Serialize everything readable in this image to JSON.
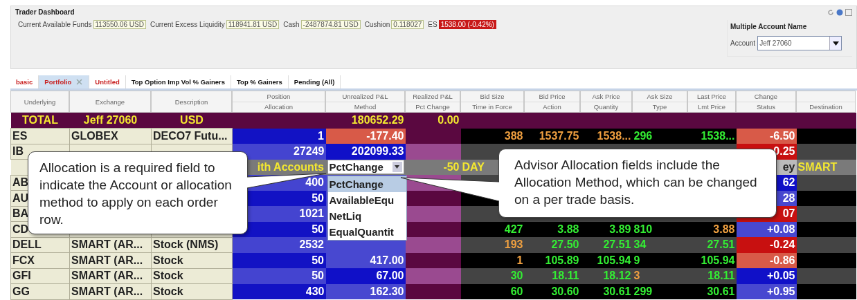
{
  "window": {
    "title": "Trader Dashboard"
  },
  "metrics": [
    {
      "label": "Current Available Funds",
      "value": "113550.06 USD",
      "kind": "plain"
    },
    {
      "label": "Current Excess Liquidity",
      "value": "118941.81 USD",
      "kind": "plain"
    },
    {
      "label": "Cash",
      "value": "-2487874.81 USD",
      "kind": "plain"
    },
    {
      "label": "Cushion",
      "value": "0.118027",
      "kind": "plain"
    },
    {
      "label": "ES",
      "value": "1538.00 (-0.42%)",
      "kind": "alert"
    }
  ],
  "account_panel": {
    "title": "Multiple Account Name",
    "label": "Account",
    "value": "Jeff 27060"
  },
  "tabs": [
    {
      "label": "basic",
      "selected": false,
      "color": "#c82020"
    },
    {
      "label": "Portfolio",
      "selected": true,
      "color": "#c82020"
    },
    {
      "label": "Untitled",
      "selected": false,
      "color": "#c82020"
    },
    {
      "label": "Top Option Imp Vol % Gainers",
      "selected": false,
      "color": "#111111"
    },
    {
      "label": "Top % Gainers",
      "selected": false,
      "color": "#111111"
    },
    {
      "label": "Pending (All)",
      "selected": false,
      "color": "#111111"
    }
  ],
  "columns": [
    {
      "top": "Underlying"
    },
    {
      "top": "Exchange"
    },
    {
      "top": "Description"
    },
    {
      "top": "Position",
      "bottom": "Allocation"
    },
    {
      "top": "Unrealized P&L",
      "bottom": "Method"
    },
    {
      "top": "Realized P&L",
      "bottom": "Pct Change"
    },
    {
      "top": "Bid Size",
      "bottom": "Time in Force"
    },
    {
      "top": "Bid Price",
      "bottom": "Action"
    },
    {
      "top": "Ask Price",
      "bottom": "Quantity"
    },
    {
      "top": "Ask Size",
      "bottom": "Type"
    },
    {
      "top": "Last Price",
      "bottom": "Lmt Price"
    },
    {
      "top": "Change",
      "bottom": "Status"
    },
    {
      "bottom": "Destination"
    }
  ],
  "rows": [
    {
      "kind": "total",
      "cells": [
        {
          "text": "TOTAL"
        },
        {
          "text": "Jeff 27060"
        },
        {
          "text": "USD"
        },
        null,
        {
          "text": "180652.29"
        },
        {
          "text": "0.00"
        },
        null,
        null,
        null,
        null,
        null,
        null,
        null
      ]
    },
    {
      "kind": "position",
      "cells": [
        {
          "text": "ES"
        },
        {
          "text": "GLOBEX"
        },
        {
          "text": "DECO7 Futu..."
        },
        {
          "text": "1"
        },
        {
          "text": "-177.40",
          "color": "#d85a48"
        },
        null,
        {
          "text": "388",
          "color": "#f0a040"
        },
        {
          "text": "1537.75",
          "color": "#f0a040"
        },
        {
          "text": "1538...",
          "color": "#f0a040"
        },
        {
          "text": "296",
          "color": "#33ee33"
        },
        {
          "text": "1538...",
          "color": "#33ee33"
        },
        {
          "text": "-6.50",
          "color": "#d85a48"
        },
        null
      ]
    },
    {
      "kind": "position",
      "cells": [
        {
          "text": "IB"
        },
        null,
        null,
        {
          "text": "27249"
        },
        {
          "text": "202099.33",
          "color": "#1010c8"
        },
        null,
        null,
        null,
        null,
        null,
        null,
        {
          "text": "0.25",
          "color": "#c81010"
        },
        null
      ]
    },
    {
      "kind": "order",
      "cells": [
        null,
        null,
        null,
        {
          "text": "ith Accounts"
        },
        {
          "text": "PctChange",
          "kind": "dropdown"
        },
        {
          "text": "-50"
        },
        {
          "text": "DAY"
        },
        null,
        null,
        null,
        null,
        {
          "text": "ey"
        },
        {
          "text": "SMART"
        }
      ]
    },
    {
      "kind": "position",
      "cells": [
        {
          "text": "AB"
        },
        null,
        null,
        {
          "text": "400"
        },
        null,
        null,
        null,
        null,
        null,
        null,
        null,
        {
          "text": "62",
          "color": "#1010c8"
        },
        null
      ]
    },
    {
      "kind": "position",
      "cells": [
        {
          "text": "AU"
        },
        null,
        null,
        {
          "text": "50"
        },
        null,
        null,
        null,
        null,
        null,
        null,
        null,
        {
          "text": "28",
          "color": "#4848d0"
        },
        null
      ]
    },
    {
      "kind": "position",
      "cells": [
        {
          "text": "BA"
        },
        null,
        null,
        {
          "text": "1021"
        },
        null,
        null,
        null,
        null,
        null,
        null,
        null,
        {
          "text": "07",
          "color": "#c81010"
        },
        null
      ]
    },
    {
      "kind": "position",
      "cells": [
        {
          "text": "CD"
        },
        null,
        null,
        {
          "text": "50"
        },
        null,
        null,
        {
          "text": "427",
          "color": "#33ee33"
        },
        {
          "text": "3.88",
          "color": "#33ee33"
        },
        {
          "text": "3.89",
          "color": "#33ee33"
        },
        {
          "text": "810",
          "color": "#33ee33"
        },
        {
          "text": "3.88",
          "color": "#f0a040"
        },
        {
          "text": "+0.08",
          "color": "#4848d0"
        },
        null
      ]
    },
    {
      "kind": "position",
      "cells": [
        {
          "text": "DELL"
        },
        {
          "text": "SMART (AR..."
        },
        {
          "text": "Stock (NMS)"
        },
        {
          "text": "2532"
        },
        null,
        null,
        {
          "text": "193",
          "color": "#f0a040"
        },
        {
          "text": "27.50",
          "color": "#33ee33"
        },
        {
          "text": "27.51",
          "color": "#33ee33"
        },
        {
          "text": "34",
          "color": "#33ee33"
        },
        {
          "text": "27.51",
          "color": "#33ee33"
        },
        {
          "text": "-0.24",
          "color": "#c81010"
        },
        null
      ]
    },
    {
      "kind": "position",
      "cells": [
        {
          "text": "FCX"
        },
        {
          "text": "SMART (AR..."
        },
        {
          "text": "Stock"
        },
        {
          "text": "50"
        },
        {
          "text": "417.00",
          "color": "#4848d0"
        },
        null,
        {
          "text": "1",
          "color": "#f0a040"
        },
        {
          "text": "105.89",
          "color": "#33ee33"
        },
        {
          "text": "105.94",
          "color": "#33ee33"
        },
        {
          "text": "9",
          "color": "#33ee33"
        },
        {
          "text": "105.94",
          "color": "#33ee33"
        },
        {
          "text": "-0.86",
          "color": "#d85a48"
        },
        null
      ]
    },
    {
      "kind": "position",
      "cells": [
        {
          "text": "GFI"
        },
        {
          "text": "SMART (AR..."
        },
        {
          "text": "Stock"
        },
        {
          "text": "50"
        },
        {
          "text": "67.00",
          "color": "#1010c8"
        },
        null,
        {
          "text": "30",
          "color": "#33ee33"
        },
        {
          "text": "18.11",
          "color": "#33ee33"
        },
        {
          "text": "18.12",
          "color": "#33ee33"
        },
        {
          "text": "3",
          "color": "#f0a040"
        },
        {
          "text": "18.11",
          "color": "#33ee33"
        },
        {
          "text": "+0.05",
          "color": "#1010c8"
        },
        null
      ]
    },
    {
      "kind": "position",
      "cells": [
        {
          "text": "GG"
        },
        {
          "text": "SMART (AR..."
        },
        {
          "text": "Stock"
        },
        {
          "text": "430"
        },
        {
          "text": "162.30",
          "color": "#4848d0"
        },
        null,
        {
          "text": "60",
          "color": "#33ee33"
        },
        {
          "text": "30.60",
          "color": "#33ee33"
        },
        {
          "text": "30.61",
          "color": "#33ee33"
        },
        {
          "text": "299",
          "color": "#33ee33"
        },
        {
          "text": "30.61",
          "color": "#33ee33"
        },
        {
          "text": "+0.95",
          "color": "#4848d0"
        },
        null
      ]
    }
  ],
  "method_dropdown": {
    "items": [
      {
        "label": "PctChange",
        "selected": true
      },
      {
        "label": "AvailableEqu",
        "selected": false
      },
      {
        "label": "NetLiq",
        "selected": false
      },
      {
        "label": "EqualQuantit",
        "selected": false
      }
    ]
  },
  "callouts": [
    {
      "text": "Allocation is a required field to indicate the Account or allocation method to apply on each order row."
    },
    {
      "text": "Advisor Allocation fields include the Allocation Method, which can be changed on a per trade basis."
    }
  ]
}
